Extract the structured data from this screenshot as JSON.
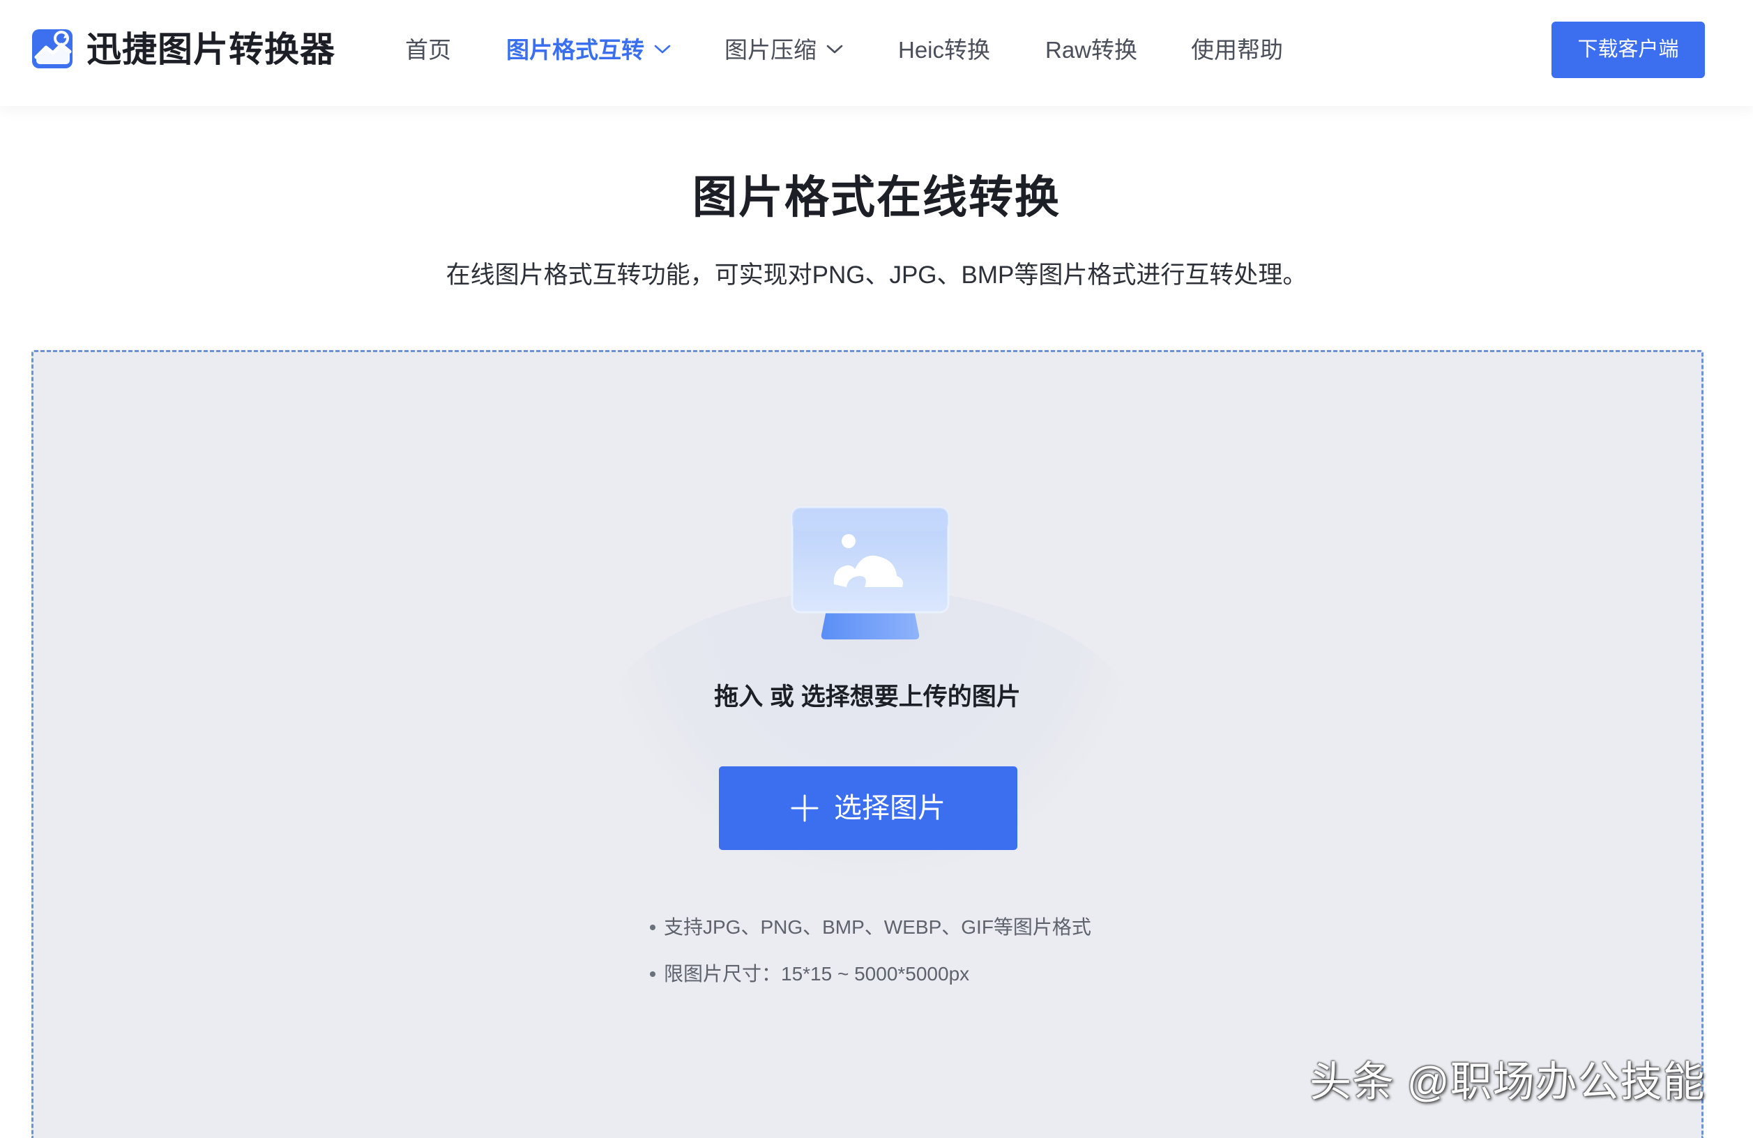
{
  "header": {
    "brand_name": "迅捷图片转换器",
    "nav": {
      "home": "首页",
      "format_convert": "图片格式互转",
      "compress": "图片压缩",
      "heic": "Heic转换",
      "raw": "Raw转换",
      "help": "使用帮助"
    },
    "download_label": "下载客户端"
  },
  "main": {
    "title": "图片格式在线转换",
    "subtitle": "在线图片格式互转功能，可实现对PNG、JPG、BMP等图片格式进行互转处理。",
    "dropzone": {
      "prompt": "拖入 或 选择想要上传的图片",
      "select_label": "选择图片",
      "tips": [
        "支持JPG、PNG、BMP、WEBP、GIF等图片格式",
        "限图片尺寸：15*15 ~ 5000*5000px"
      ]
    }
  },
  "watermark": "头条 @职场办公技能",
  "colors": {
    "accent": "#3c6ef0",
    "active_nav": "#3a6ff0",
    "dropzone_bg": "#ebecf1",
    "dropzone_border": "#6b93d6"
  },
  "icons": {
    "logo": "image-convert-logo-icon",
    "dropdown": "chevron-down-icon",
    "upload": "image-upload-illustration-icon",
    "plus": "plus-icon"
  }
}
